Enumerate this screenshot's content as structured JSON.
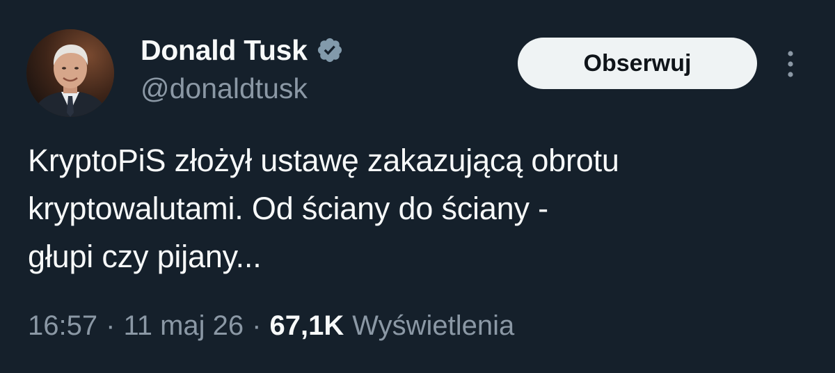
{
  "tweet": {
    "author": {
      "display_name": "Donald Tusk",
      "handle": "@donaldtusk",
      "verified": true,
      "verified_icon": "verified-badge-icon",
      "avatar": "profile-photo"
    },
    "follow_button_label": "Obserwuj",
    "more_icon": "more-options-icon",
    "text_lines": [
      "KryptoPiS złożył ustawę zakazującą obrotu",
      "kryptowalutami. Od ściany do ściany -",
      "głupi czy pijany..."
    ],
    "meta": {
      "time": "16:57",
      "separator": "·",
      "date": "11 maj 26",
      "views_count": "67,1K",
      "views_label": "Wyświetlenia"
    }
  },
  "colors": {
    "background": "#15202b",
    "primary_text": "#f7f9f9",
    "secondary_text": "#8b98a5",
    "button_bg": "#eff3f4",
    "verified_badge": "#829aab"
  }
}
